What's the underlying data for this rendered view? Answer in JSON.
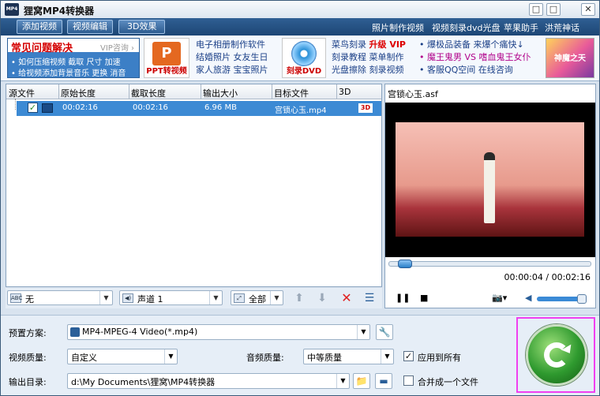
{
  "app": {
    "title": "狸窝MP4转换器",
    "icon_text": "MP4"
  },
  "window": {
    "minimize": "□",
    "maximize": "□",
    "close": "✕"
  },
  "toolbar": {
    "add_video": "添加视频",
    "edit_video": "视频编辑",
    "effect_3d": "3D效果",
    "links": [
      "照片制作视频",
      "视频刻录dvd光盘",
      "苹果助手",
      "洪荒神话"
    ]
  },
  "banner": {
    "faq_title": "常见问题解决",
    "vip": "VIP咨询 ›",
    "faq_lines": [
      "• 如何压缩视频 截取 尺寸 加速",
      "• 给视频添加背景音乐 更换 消音"
    ],
    "ppt_label": "PPT转视频",
    "ppt_icon": "P",
    "album": [
      "电子相册制作软件",
      "结婚照片 女友生日",
      "家人旅游 宝宝照片"
    ],
    "dvd_label": "刻录DVD",
    "burn": [
      {
        "a": "菜鸟刻录",
        "b": "升级 VIP"
      },
      {
        "a": "刻录教程",
        "b": "菜单制作"
      },
      {
        "a": "光盘擦除",
        "b": "刻录视频"
      }
    ],
    "game_lines": [
      "• 爆极品装备 来爆个痛快↓",
      "• 魔王鬼男 VS 嗜血鬼王女仆",
      "• 客服QQ空间 在线咨询"
    ],
    "game_label": "神魔之天"
  },
  "file_list": {
    "columns": [
      "源文件",
      "原始长度",
      "截取长度",
      "输出大小",
      "目标文件",
      "3D"
    ],
    "rows": [
      {
        "orig": "00:02:16",
        "cut": "00:02:16",
        "size": "6.96 MB",
        "target": "宫锁心玉.mp4",
        "d3": "3D"
      }
    ]
  },
  "list_controls": {
    "subtitle": "无",
    "audio": "声道 1",
    "mode": "全部",
    "subtitle_icon": "ABC",
    "audio_icon": "◀)",
    "mode_icon": "⤢"
  },
  "preview": {
    "file": "宫锁心玉.asf",
    "time": "00:00:04 / 00:02:16",
    "progress": 0.03,
    "volume": 0.9
  },
  "settings": {
    "preset_label": "预置方案:",
    "preset_value": "MP4-MPEG-4 Video(*.mp4)",
    "vq_label": "视频质量:",
    "vq_value": "自定义",
    "aq_label": "音频质量:",
    "aq_value": "中等质量",
    "apply_all": "应用到所有",
    "apply_all_checked": true,
    "out_label": "输出目录:",
    "out_value": "d:\\My Documents\\狸窝\\MP4转换器",
    "merge": "合并成一个文件",
    "merge_checked": false
  },
  "colors": {
    "toolbar": "#1d4675",
    "selected_row": "#3c8ad4",
    "convert": "#2f9a2f",
    "highlight": "#f040f0"
  }
}
